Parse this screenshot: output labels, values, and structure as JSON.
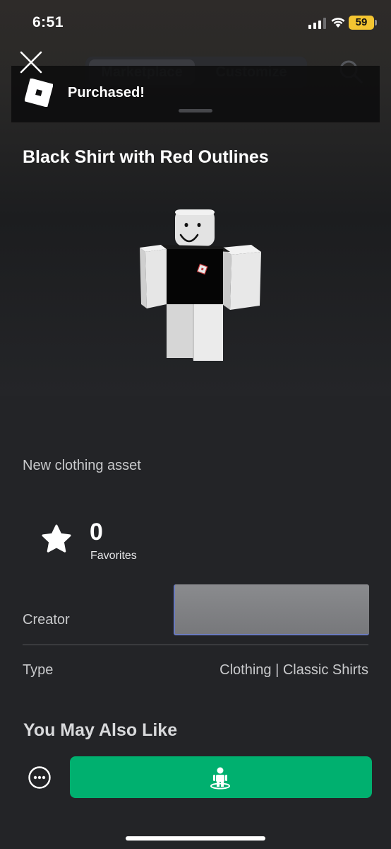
{
  "status_bar": {
    "time": "6:51",
    "battery_level": "59",
    "battery_color": "#f4c531"
  },
  "nav": {
    "tabs": [
      {
        "label": "Marketplace",
        "active": true
      },
      {
        "label": "Customize",
        "active": false
      }
    ],
    "close_icon": "close-icon",
    "search_icon": "search-icon"
  },
  "banner": {
    "text": "Purchased!",
    "logo_icon": "roblox-logo"
  },
  "item": {
    "title": "Black Shirt with Red Outlines",
    "description": "New clothing asset",
    "favorites_count": "0",
    "favorites_label": "Favorites"
  },
  "details": {
    "creator_label": "Creator",
    "type_label": "Type",
    "type_value": "Clothing | Classic Shirts"
  },
  "recommendations": {
    "heading": "You May Also Like"
  },
  "actions": {
    "more_icon": "ellipsis-icon",
    "try_on_icon": "avatar-try-on-icon",
    "try_on_color": "#00b06f"
  },
  "theme": {
    "background": "#232427",
    "accent": "#00b06f"
  }
}
